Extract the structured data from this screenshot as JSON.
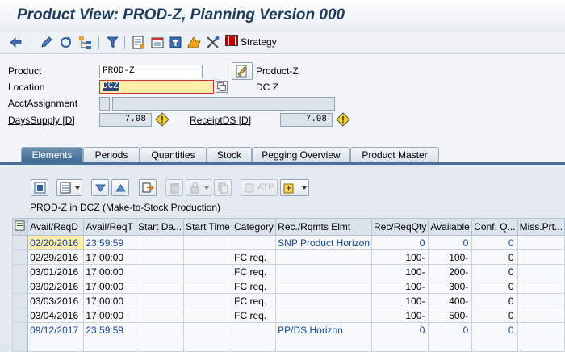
{
  "window": {
    "title": "Product View: PROD-Z, Planning Version 000"
  },
  "toolbar": {
    "strategy_label": "Strategy"
  },
  "form": {
    "product_label": "Product",
    "product_value": "PROD-Z",
    "product_desc": "Product-Z",
    "location_label": "Location",
    "location_value": "DCZ",
    "location_desc": "DC Z",
    "acct_label": "AcctAssignment",
    "acct_value": "",
    "acct_desc": "",
    "dayssupply_label": "DaysSupply [D]",
    "dayssupply_value": "7.98",
    "receiptds_label": "ReceiptDS [D]",
    "receiptds_value": "7.98"
  },
  "tabs": [
    {
      "label": "Elements",
      "active": true
    },
    {
      "label": "Periods"
    },
    {
      "label": "Quantities"
    },
    {
      "label": "Stock"
    },
    {
      "label": "Pegging Overview"
    },
    {
      "label": "Product Master"
    }
  ],
  "grid_toolbar": {
    "atp_label": "ATP"
  },
  "grid": {
    "title": "PROD-Z in DCZ (Make-to-Stock Production)",
    "columns": [
      "Avail/ReqD",
      "Avail/ReqT",
      "Start Da...",
      "Start Time",
      "Category",
      "Rec./Rqmts Elmt",
      "Rec/ReqQty",
      "Available",
      "Conf. Q...",
      "Miss.Prt..."
    ],
    "rows": [
      {
        "cells": [
          "02/20/2016",
          "23:59:59",
          "",
          "",
          "",
          "SNP Product Horizon",
          "0",
          "0",
          "0",
          ""
        ],
        "blue": true,
        "highlight_first": true
      },
      {
        "cells": [
          "02/29/2016",
          "17:00:00",
          "",
          "",
          "FC req.",
          "",
          "100-",
          "100-",
          "0",
          ""
        ]
      },
      {
        "cells": [
          "03/01/2016",
          "17:00:00",
          "",
          "",
          "FC req.",
          "",
          "100-",
          "200-",
          "0",
          ""
        ]
      },
      {
        "cells": [
          "03/02/2016",
          "17:00:00",
          "",
          "",
          "FC req.",
          "",
          "100-",
          "300-",
          "0",
          ""
        ]
      },
      {
        "cells": [
          "03/03/2016",
          "17:00:00",
          "",
          "",
          "FC req.",
          "",
          "100-",
          "400-",
          "0",
          ""
        ]
      },
      {
        "cells": [
          "03/04/2016",
          "17:00:00",
          "",
          "",
          "FC req.",
          "",
          "100-",
          "500-",
          "0",
          ""
        ]
      },
      {
        "cells": [
          "09/12/2017",
          "23:59:59",
          "",
          "",
          "",
          "PP/DS Horizon",
          "0",
          "0",
          "0",
          ""
        ],
        "blue": true
      }
    ]
  },
  "colors": {
    "title": "#1d3a5c",
    "active_tab": "#4a7099",
    "highlight": "#ffeeaa",
    "blue_text": "#1746a2"
  }
}
